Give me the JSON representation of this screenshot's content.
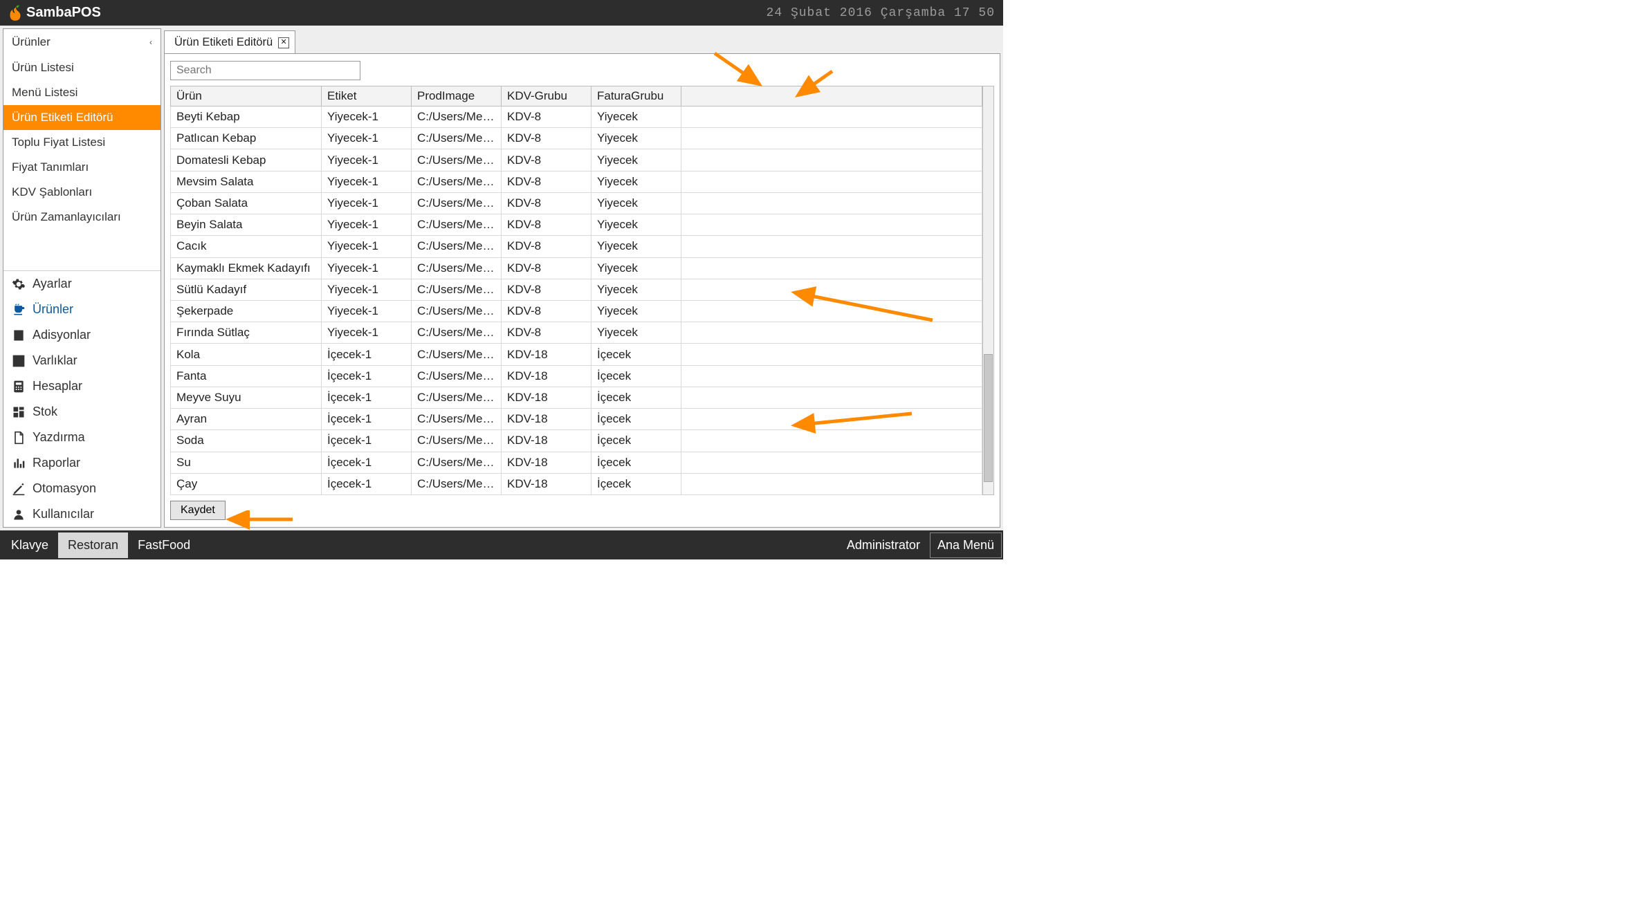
{
  "app": {
    "name": "SambaPOS",
    "datetime": "24 Şubat 2016 Çarşamba 17 50"
  },
  "sidebar": {
    "header": "Ürünler",
    "items": [
      "Ürün Listesi",
      "Menü Listesi",
      "Ürün Etiketi Editörü",
      "Toplu Fiyat Listesi",
      "Fiyat Tanımları",
      "KDV Şablonları",
      "Ürün Zamanlayıcıları"
    ],
    "active_index": 2,
    "nav": [
      {
        "label": "Ayarlar",
        "icon": "gear"
      },
      {
        "label": "Ürünler",
        "icon": "cup",
        "active": true
      },
      {
        "label": "Adisyonlar",
        "icon": "book"
      },
      {
        "label": "Varlıklar",
        "icon": "grid"
      },
      {
        "label": "Hesaplar",
        "icon": "calc"
      },
      {
        "label": "Stok",
        "icon": "dashboard"
      },
      {
        "label": "Yazdırma",
        "icon": "document"
      },
      {
        "label": "Raporlar",
        "icon": "bars"
      },
      {
        "label": "Otomasyon",
        "icon": "pencil"
      },
      {
        "label": "Kullanıcılar",
        "icon": "user"
      }
    ]
  },
  "tab": {
    "title": "Ürün Etiketi Editörü"
  },
  "search": {
    "placeholder": "Search"
  },
  "table": {
    "columns": [
      "Ürün",
      "Etiket",
      "ProdImage",
      "KDV-Grubu",
      "FaturaGrubu"
    ],
    "rows": [
      {
        "urun": "Beyti Kebap",
        "etiket": "Yiyecek-1",
        "img": "C:/Users/Meh...",
        "kdv": "KDV-8",
        "fatura": "Yiyecek"
      },
      {
        "urun": "Patlıcan Kebap",
        "etiket": "Yiyecek-1",
        "img": "C:/Users/Meh...",
        "kdv": "KDV-8",
        "fatura": "Yiyecek"
      },
      {
        "urun": "Domatesli Kebap",
        "etiket": "Yiyecek-1",
        "img": "C:/Users/Meh...",
        "kdv": "KDV-8",
        "fatura": "Yiyecek"
      },
      {
        "urun": "Mevsim Salata",
        "etiket": "Yiyecek-1",
        "img": "C:/Users/Meh...",
        "kdv": "KDV-8",
        "fatura": "Yiyecek"
      },
      {
        "urun": "Çoban Salata",
        "etiket": "Yiyecek-1",
        "img": "C:/Users/Meh...",
        "kdv": "KDV-8",
        "fatura": "Yiyecek"
      },
      {
        "urun": "Beyin Salata",
        "etiket": "Yiyecek-1",
        "img": "C:/Users/Meh...",
        "kdv": "KDV-8",
        "fatura": "Yiyecek"
      },
      {
        "urun": "Cacık",
        "etiket": "Yiyecek-1",
        "img": "C:/Users/Meh...",
        "kdv": "KDV-8",
        "fatura": "Yiyecek"
      },
      {
        "urun": "Kaymaklı Ekmek Kadayıfı",
        "etiket": "Yiyecek-1",
        "img": "C:/Users/Meh...",
        "kdv": "KDV-8",
        "fatura": "Yiyecek"
      },
      {
        "urun": "Sütlü Kadayıf",
        "etiket": "Yiyecek-1",
        "img": "C:/Users/Meh...",
        "kdv": "KDV-8",
        "fatura": "Yiyecek"
      },
      {
        "urun": "Şekerpade",
        "etiket": "Yiyecek-1",
        "img": "C:/Users/Meh...",
        "kdv": "KDV-8",
        "fatura": "Yiyecek"
      },
      {
        "urun": "Fırında Sütlaç",
        "etiket": "Yiyecek-1",
        "img": "C:/Users/Meh...",
        "kdv": "KDV-8",
        "fatura": "Yiyecek"
      },
      {
        "urun": "Kola",
        "etiket": "İçecek-1",
        "img": "C:/Users/Meh...",
        "kdv": "KDV-18",
        "fatura": "İçecek"
      },
      {
        "urun": "Fanta",
        "etiket": "İçecek-1",
        "img": "C:/Users/Meh...",
        "kdv": "KDV-18",
        "fatura": "İçecek"
      },
      {
        "urun": "Meyve Suyu",
        "etiket": "İçecek-1",
        "img": "C:/Users/Meh...",
        "kdv": "KDV-18",
        "fatura": "İçecek"
      },
      {
        "urun": "Ayran",
        "etiket": "İçecek-1",
        "img": "C:/Users/Meh...",
        "kdv": "KDV-18",
        "fatura": "İçecek"
      },
      {
        "urun": "Soda",
        "etiket": "İçecek-1",
        "img": "C:/Users/Meh...",
        "kdv": "KDV-18",
        "fatura": "İçecek"
      },
      {
        "urun": "Su",
        "etiket": "İçecek-1",
        "img": "C:/Users/Meh...",
        "kdv": "KDV-18",
        "fatura": "İçecek"
      },
      {
        "urun": "Çay",
        "etiket": "İçecek-1",
        "img": "C:/Users/Meh...",
        "kdv": "KDV-18",
        "fatura": "İçecek"
      }
    ]
  },
  "buttons": {
    "save": "Kaydet"
  },
  "bottombar": {
    "left": [
      "Klavye",
      "Restoran",
      "FastFood"
    ],
    "active_index": 1,
    "user": "Administrator",
    "main_menu": "Ana Menü"
  }
}
